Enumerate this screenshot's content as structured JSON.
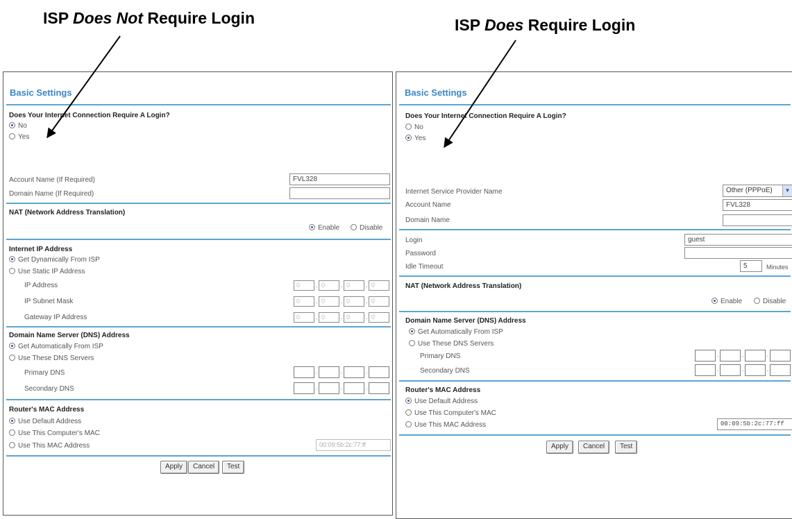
{
  "captions": {
    "left_pre": "ISP ",
    "left_em": "Does Not",
    "left_post": " Require Login",
    "right_pre": "ISP ",
    "right_em": "Does",
    "right_post": " Require Login"
  },
  "left": {
    "title": "Basic Settings",
    "login_question": "Does Your Internet Connection Require A Login?",
    "opt_no": "No",
    "opt_yes": "Yes",
    "account_label": "Account Name (If Required)",
    "account_value": "FVL328",
    "domain_label": "Domain Name (If Required)",
    "nat_title": "NAT (Network Address Translation)",
    "enable": "Enable",
    "disable": "Disable",
    "ip_title": "Internet IP Address",
    "ip_dynamic": "Get Dynamically From ISP",
    "ip_static": "Use Static IP Address",
    "ip_address": "IP Address",
    "ip_subnet": "IP Subnet Mask",
    "ip_gateway": "Gateway IP Address",
    "octet_zero": "0",
    "dns_title": "Domain Name Server (DNS) Address",
    "dns_auto": "Get Automatically From ISP",
    "dns_manual": "Use These DNS Servers",
    "dns_primary": "Primary DNS",
    "dns_secondary": "Secondary DNS",
    "mac_title": "Router's MAC Address",
    "mac_default": "Use Default Address",
    "mac_computer": "Use This Computer's MAC",
    "mac_this": "Use This MAC Address",
    "mac_value": "00:09:5b:2c:77:ff",
    "apply": "Apply",
    "cancel": "Cancel",
    "test": "Test"
  },
  "right": {
    "title": "Basic Settings",
    "login_question": "Does Your Internet Connection Require A Login?",
    "opt_no": "No",
    "opt_yes": "Yes",
    "isp_label": "Internet Service Provider Name",
    "isp_value": "Other (PPPoE)",
    "account_label": "Account Name",
    "account_value": "FVL328",
    "domain_label": "Domain Name",
    "login_label": "Login",
    "login_value": "guest",
    "password_label": "Password",
    "idle_label": "Idle Timeout",
    "idle_value": "5",
    "idle_unit": "Minutes",
    "nat_title": "NAT (Network Address Translation)",
    "enable": "Enable",
    "disable": "Disable",
    "dns_title": "Domain Name Server (DNS) Address",
    "dns_auto": "Get Automatically From ISP",
    "dns_manual": "Use These DNS Servers",
    "dns_primary": "Primary DNS",
    "dns_secondary": "Secondary DNS",
    "mac_title": "Router's MAC Address",
    "mac_default": "Use Default Address",
    "mac_computer": "Use This Computer's MAC",
    "mac_this": "Use This MAC Address",
    "mac_value": "00:09:5b:2c:77:ff",
    "apply": "Apply",
    "cancel": "Cancel",
    "test": "Test"
  },
  "colors": {
    "title_blue": "#3b86c6",
    "rule_blue": "#5aa6cf"
  }
}
